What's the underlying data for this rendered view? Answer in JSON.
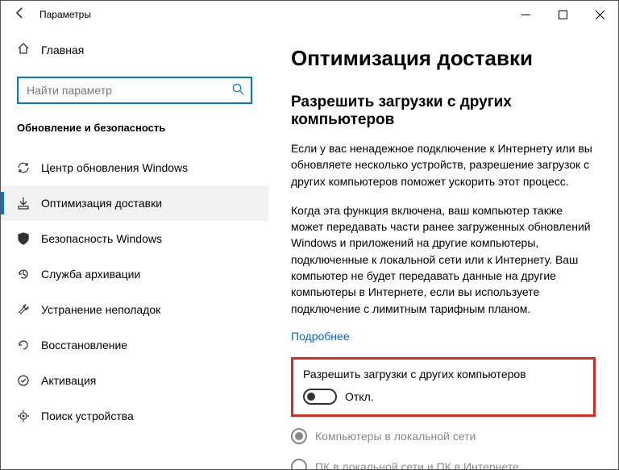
{
  "window": {
    "title": "Параметры"
  },
  "sidebar": {
    "home": "Главная",
    "search_placeholder": "Найти параметр",
    "section": "Обновление и безопасность",
    "items": [
      {
        "label": "Центр обновления Windows"
      },
      {
        "label": "Оптимизация доставки"
      },
      {
        "label": "Безопасность Windows"
      },
      {
        "label": "Служба архивации"
      },
      {
        "label": "Устранение неполадок"
      },
      {
        "label": "Восстановление"
      },
      {
        "label": "Активация"
      },
      {
        "label": "Поиск устройства"
      }
    ]
  },
  "main": {
    "heading": "Оптимизация доставки",
    "subheading": "Разрешить загрузки с других компьютеров",
    "para1": "Если у вас ненадежное подключение к Интернету или вы обновляете несколько устройств, разрешение загрузок с других компьютеров поможет ускорить этот процесс.",
    "para2": "Когда эта функция включена, ваш компьютер также может передавать части ранее загруженных обновлений Windows и приложений на другие компьютеры, подключенные к локальной сети или к Интернету. Ваш компьютер не будет передавать данные на другие компьютеры в Интернете, если вы используете подключение с лимитным тарифным планом.",
    "more": "Подробнее",
    "toggle_label": "Разрешить загрузки с других компьютеров",
    "toggle_state": "Откл.",
    "radio1": "Компьютеры в локальной сети",
    "radio2": "ПК в локальной сети и ПК в Интернете"
  }
}
